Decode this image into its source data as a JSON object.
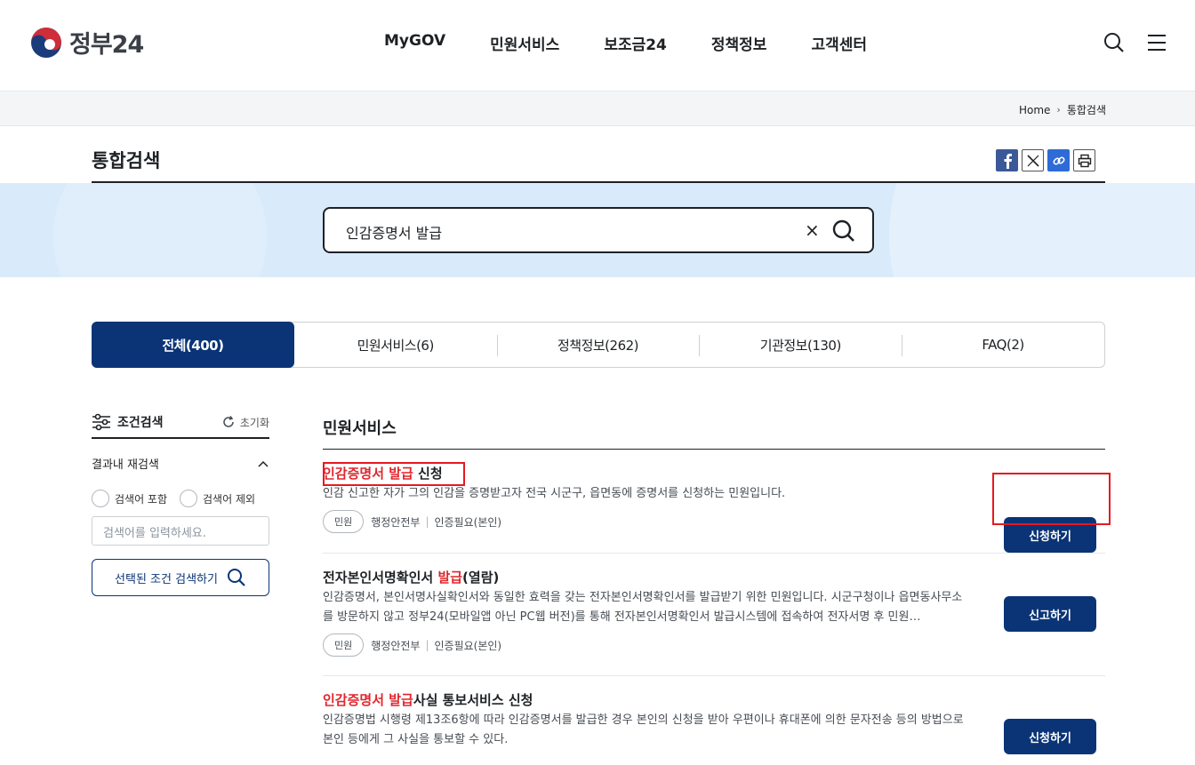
{
  "header": {
    "logo_text": "정부24",
    "nav": [
      "MyGOV",
      "민원서비스",
      "보조금24",
      "정책정보",
      "고객센터"
    ]
  },
  "breadcrumb": {
    "home": "Home",
    "current": "통합검색"
  },
  "page": {
    "title": "통합검색"
  },
  "search": {
    "query": "인감증명서 발급",
    "clear": "×"
  },
  "tabs": [
    {
      "label": "전체(400)",
      "active": true
    },
    {
      "label": "민원서비스(6)"
    },
    {
      "label": "정책정보(262)"
    },
    {
      "label": "기관정보(130)"
    },
    {
      "label": "FAQ(2)"
    }
  ],
  "filter": {
    "title": "조건검색",
    "reset": "초기화",
    "sub_title": "결과내 재검색",
    "include": "검색어 포함",
    "exclude": "검색어 제외",
    "placeholder": "검색어를 입력하세요.",
    "button": "선택된 조건 검색하기"
  },
  "results": {
    "section_title": "민원서비스",
    "items": [
      {
        "title_hl": "인감증명서 발급",
        "title_rest": " 신청",
        "desc": "인감 신고한 자가 그의 인감을 증명받고자 전국 시군구, 읍면동에 증명서를 신청하는 민원입니다.",
        "tag": "민원",
        "org": "행정안전부",
        "auth": "인증필요(본인)",
        "button": "신청하기"
      },
      {
        "title_pre": "전자본인서명확인서 ",
        "title_hl": "발급",
        "title_rest": "(열람)",
        "desc": "인감증명서, 본인서명사실확인서와 동일한 효력을 갖는 전자본인서명확인서를 발급받기 위한 민원입니다. 시군구청이나 읍면동사무소를 방문하지 않고 정부24(모바일앱 아닌 PC웹 버전)를 통해 전자본인서명확인서 발급시스템에 접속하여 전자서명 후 민원…",
        "tag": "민원",
        "org": "행정안전부",
        "auth": "인증필요(본인)",
        "button": "신고하기"
      },
      {
        "title_hl": "인감증명서 발급",
        "title_rest": "사실 통보서비스 신청",
        "desc": "인감증명법 시행령 제13조6항에 따라 인감증명서를 발급한 경우 본인의 신청을 받아 우편이나 휴대폰에 의한 문자전송 등의 방법으로 본인 등에게 그 사실을 통보할 수 있다.",
        "button": "신청하기"
      }
    ]
  },
  "colors": {
    "navy": "#0b3477",
    "highlight": "#e0262c",
    "band": "#d9ebfb"
  }
}
